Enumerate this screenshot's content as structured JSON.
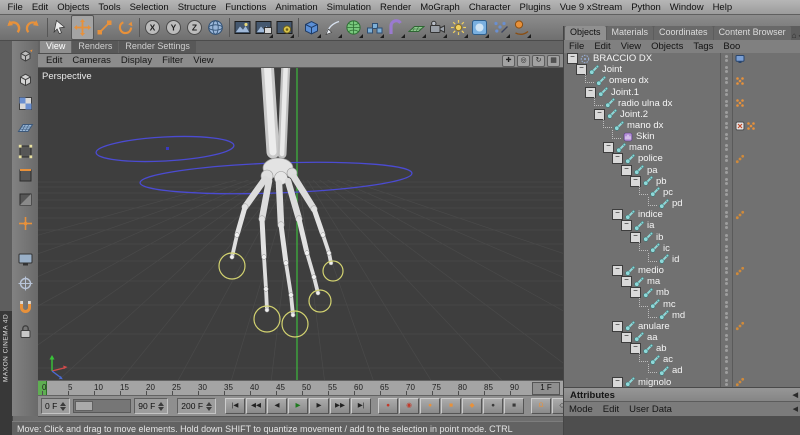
{
  "colors": {
    "accent_orange": "#e8913a",
    "viewport_bg": "#3e3e3e",
    "controller_blue": "#4b4bd2",
    "ik_goal_yellow": "#d2d270",
    "axis_green": "#3db83d"
  },
  "menubar": {
    "items": [
      "File",
      "Edit",
      "Objects",
      "Tools",
      "Selection",
      "Structure",
      "Functions",
      "Animation",
      "Simulation",
      "Render",
      "MoGraph",
      "Character",
      "Plugins",
      "Vue 9 xStream",
      "Python",
      "Window",
      "Help"
    ]
  },
  "toolbar": {
    "icons": [
      {
        "name": "undo-icon",
        "kind": "undo"
      },
      {
        "name": "redo-icon",
        "kind": "redo"
      },
      {
        "separator": true
      },
      {
        "name": "live-selection-icon",
        "kind": "cursor"
      },
      {
        "name": "move-tool-icon",
        "kind": "move",
        "active": true
      },
      {
        "name": "scale-tool-icon",
        "kind": "scale"
      },
      {
        "name": "rotate-tool-icon",
        "kind": "rotate"
      },
      {
        "separator": true
      },
      {
        "name": "lock-x-axis-icon",
        "kind": "circleletter",
        "letter": "X"
      },
      {
        "name": "lock-y-axis-icon",
        "kind": "circleletter",
        "letter": "Y"
      },
      {
        "name": "lock-z-axis-icon",
        "kind": "circleletter",
        "letter": "Z"
      },
      {
        "name": "coordinate-system-icon",
        "kind": "globe"
      },
      {
        "separator": true
      },
      {
        "name": "render-view-icon",
        "kind": "renderscene"
      },
      {
        "name": "render-picture-viewer-icon",
        "kind": "renderpv",
        "dropdown": true
      },
      {
        "name": "render-settings-icon",
        "kind": "rendergear",
        "dropdown": true
      },
      {
        "separator": true
      },
      {
        "name": "add-primitive-icon",
        "kind": "cube",
        "dropdown": true
      },
      {
        "name": "add-spline-icon",
        "kind": "pen",
        "dropdown": true
      },
      {
        "name": "add-subdivision-surface-icon",
        "kind": "cage",
        "dropdown": true
      },
      {
        "name": "add-array-icon",
        "kind": "array",
        "dropdown": true
      },
      {
        "name": "add-deformer-icon",
        "kind": "bend",
        "dropdown": true
      },
      {
        "name": "add-floor-icon",
        "kind": "floor",
        "dropdown": true
      },
      {
        "name": "add-camera-icon",
        "kind": "camera",
        "dropdown": true
      },
      {
        "name": "add-light-icon",
        "kind": "light",
        "dropdown": true
      },
      {
        "name": "add-sky-icon",
        "kind": "sky",
        "dropdown": true
      },
      {
        "name": "add-particles-icon",
        "kind": "particles",
        "dropdown": true
      },
      {
        "name": "add-dynamics-icon",
        "kind": "dynamics",
        "dropdown": true
      }
    ]
  },
  "left_toolbar": {
    "icons": [
      {
        "name": "make-editable-icon",
        "kind": "editable"
      },
      {
        "name": "model-mode-icon",
        "kind": "model"
      },
      {
        "name": "texture-mode-icon",
        "kind": "texture"
      },
      {
        "name": "workplane-mode-icon",
        "kind": "workplane"
      },
      {
        "name": "points-mode-icon",
        "kind": "points"
      },
      {
        "name": "edges-mode-icon",
        "kind": "edges"
      },
      {
        "name": "polygons-mode-icon",
        "kind": "polys"
      },
      {
        "name": "enable-axis-icon",
        "kind": "axis"
      },
      {
        "gap": true
      },
      {
        "name": "viewport-solo-icon",
        "kind": "monitor"
      },
      {
        "name": "snapping-icon",
        "kind": "snap"
      },
      {
        "name": "magnet-icon",
        "kind": "magnet"
      },
      {
        "name": "lock-workplane-icon",
        "kind": "lock"
      }
    ]
  },
  "viewport": {
    "tabs": [
      {
        "label": "View",
        "active": true
      },
      {
        "label": "Renders",
        "active": false
      },
      {
        "label": "Render Settings",
        "active": false
      }
    ],
    "menu_items": [
      "Edit",
      "Cameras",
      "Display",
      "Filter",
      "View"
    ],
    "view_icons": [
      "pan-view-icon",
      "zoom-view-icon",
      "rotate-view-icon",
      "toggle-views-icon"
    ],
    "view_label": "Perspective"
  },
  "timeline": {
    "tick_labels": [
      "0",
      "5",
      "10",
      "15",
      "20",
      "25",
      "30",
      "35",
      "40",
      "45",
      "50",
      "55",
      "60",
      "65",
      "70",
      "75",
      "80",
      "85",
      "90"
    ],
    "increment_label": "1 F"
  },
  "transport": {
    "fields": [
      {
        "name": "preview-start-field",
        "value": "0 F"
      },
      {
        "name": "preview-end-field",
        "value": "90 F"
      },
      {
        "name": "project-length-field",
        "value": "200 F"
      }
    ],
    "buttons": [
      "goto-start-button",
      "previous-key-button",
      "previous-frame-button",
      "play-button",
      "next-frame-button",
      "next-key-button",
      "goto-end-button",
      "record-keyframe-button",
      "autokeying-button",
      "record-position-toggle",
      "record-scale-toggle",
      "record-rotation-toggle",
      "record-parameter-toggle",
      "record-pla-toggle",
      "magnet-button",
      "keyframe-selection-button"
    ]
  },
  "status_bar": {
    "text": "Move: Click and drag to move elements. Hold down SHIFT to quantize movement / add to the selection in point mode. CTRL"
  },
  "brand": {
    "vertical_text": "MAXON CINEMA 4D"
  },
  "object_manager": {
    "tabs": [
      {
        "label": "Objects",
        "active": true
      },
      {
        "label": "Materials",
        "active": false
      },
      {
        "label": "Coordinates",
        "active": false
      },
      {
        "label": "Content Browser",
        "active": false
      }
    ],
    "corner_icons": [
      "home-icon",
      "collapse-panel-icon"
    ],
    "menu_items": [
      "File",
      "Edit",
      "View",
      "Objects",
      "Tags",
      "Boo"
    ],
    "tree": [
      {
        "label": "BRACCIO DX",
        "depth": 0,
        "expandable": true,
        "icon": "null",
        "tags": [
          "display"
        ]
      },
      {
        "label": "Joint",
        "depth": 1,
        "expandable": true,
        "icon": "joint",
        "tags": []
      },
      {
        "label": "omero dx",
        "depth": 2,
        "expandable": false,
        "icon": "joint",
        "tags": [
          "weights"
        ]
      },
      {
        "label": "Joint.1",
        "depth": 2,
        "expandable": true,
        "icon": "joint",
        "tags": []
      },
      {
        "label": "radio ulna dx",
        "depth": 3,
        "expandable": false,
        "icon": "joint",
        "tags": [
          "weights"
        ]
      },
      {
        "label": "Joint.2",
        "depth": 3,
        "expandable": true,
        "icon": "joint",
        "tags": []
      },
      {
        "label": "mano dx",
        "depth": 4,
        "expandable": false,
        "icon": "joint",
        "tags": [
          "expression",
          "weights"
        ]
      },
      {
        "label": "Skin",
        "depth": 5,
        "expandable": false,
        "icon": "skin",
        "tags": []
      },
      {
        "label": "mano",
        "depth": 4,
        "expandable": true,
        "icon": "joint",
        "tags": []
      },
      {
        "label": "police",
        "depth": 5,
        "expandable": true,
        "icon": "joint",
        "tags": [
          "ik"
        ]
      },
      {
        "label": "pa",
        "depth": 6,
        "expandable": true,
        "icon": "joint",
        "tags": []
      },
      {
        "label": "pb",
        "depth": 7,
        "expandable": true,
        "icon": "joint",
        "tags": []
      },
      {
        "label": "pc",
        "depth": 8,
        "expandable": false,
        "icon": "joint",
        "tags": []
      },
      {
        "label": "pd",
        "depth": 9,
        "expandable": false,
        "icon": "joint",
        "tags": []
      },
      {
        "label": "indice",
        "depth": 5,
        "expandable": true,
        "icon": "joint",
        "tags": [
          "ik"
        ]
      },
      {
        "label": "ia",
        "depth": 6,
        "expandable": true,
        "icon": "joint",
        "tags": []
      },
      {
        "label": "ib",
        "depth": 7,
        "expandable": true,
        "icon": "joint",
        "tags": []
      },
      {
        "label": "ic",
        "depth": 8,
        "expandable": false,
        "icon": "joint",
        "tags": []
      },
      {
        "label": "id",
        "depth": 9,
        "expandable": false,
        "icon": "joint",
        "tags": []
      },
      {
        "label": "medio",
        "depth": 5,
        "expandable": true,
        "icon": "joint",
        "tags": [
          "ik"
        ]
      },
      {
        "label": "ma",
        "depth": 6,
        "expandable": true,
        "icon": "joint",
        "tags": []
      },
      {
        "label": "mb",
        "depth": 7,
        "expandable": true,
        "icon": "joint",
        "tags": []
      },
      {
        "label": "mc",
        "depth": 8,
        "expandable": false,
        "icon": "joint",
        "tags": []
      },
      {
        "label": "md",
        "depth": 9,
        "expandable": false,
        "icon": "joint",
        "tags": []
      },
      {
        "label": "anulare",
        "depth": 5,
        "expandable": true,
        "icon": "joint",
        "tags": [
          "ik"
        ]
      },
      {
        "label": "aa",
        "depth": 6,
        "expandable": true,
        "icon": "joint",
        "tags": []
      },
      {
        "label": "ab",
        "depth": 7,
        "expandable": true,
        "icon": "joint",
        "tags": []
      },
      {
        "label": "ac",
        "depth": 8,
        "expandable": false,
        "icon": "joint",
        "tags": []
      },
      {
        "label": "ad",
        "depth": 9,
        "expandable": false,
        "icon": "joint",
        "tags": []
      },
      {
        "label": "mignolo",
        "depth": 5,
        "expandable": true,
        "icon": "joint",
        "tags": [
          "ik"
        ]
      }
    ]
  },
  "attributes_panel": {
    "title": "Attributes",
    "menu_items": [
      "Mode",
      "Edit",
      "User Data"
    ]
  }
}
